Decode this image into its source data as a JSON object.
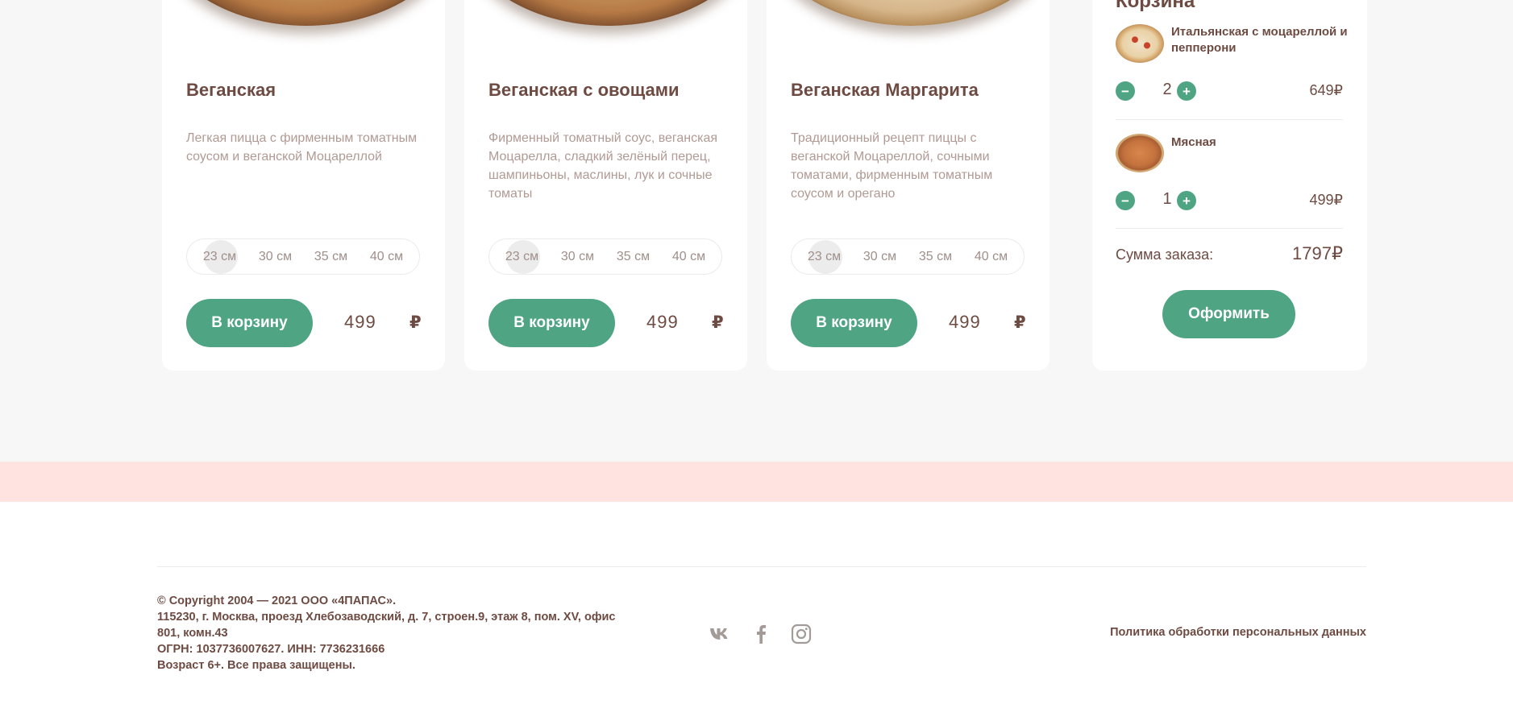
{
  "products": [
    {
      "title": "Веганская",
      "desc": "Легкая пицца с фирменным томатным соусом и веганской Моцареллой",
      "sizes": [
        "23 см",
        "30 см",
        "35 см",
        "40 см"
      ],
      "button": "В корзину",
      "price": "499",
      "currency": "₽"
    },
    {
      "title": "Веганская с овощами",
      "desc": "Фирменный томатный соус, веганская Моцарелла, сладкий зелёный перец, шампиньоны, маслины, лук и сочные томаты",
      "sizes": [
        "23 см",
        "30 см",
        "35 см",
        "40 см"
      ],
      "button": "В корзину",
      "price": "499",
      "currency": "₽"
    },
    {
      "title": "Веганская Маргарита",
      "desc": "Традиционный рецепт пиццы с веганской Моцареллой, сочными томатами, фирменным томатным соусом и орегано",
      "sizes": [
        "23 см",
        "30 см",
        "35 см",
        "40 см"
      ],
      "button": "В корзину",
      "price": "499",
      "currency": "₽"
    }
  ],
  "basket": {
    "title": "Корзина",
    "items": [
      {
        "name": "Итальянская с моцареллой и пепперони",
        "qty": "2",
        "price": "649₽",
        "minus": "−",
        "plus": "+"
      },
      {
        "name": "Мясная",
        "qty": "1",
        "price": "499₽",
        "minus": "−",
        "plus": "+"
      }
    ],
    "total_label": "Сумма заказа:",
    "total_value": "1797₽",
    "order_button": "Оформить"
  },
  "footer": {
    "lines": [
      "© Copyright 2004 — 2021 ООО «4ПАПАС».",
      "115230, г. Москва, проезд Хлебозаводский, д. 7, строен.9, этаж 8, пом. XV, офис",
      "801, комн.43",
      "ОГРН: 1037736007627.  ИНН: 7736231666",
      "Возраст 6+.  Все права защищены."
    ],
    "socials": [
      "vk-icon",
      "facebook-icon",
      "instagram-icon"
    ],
    "policy": "Политика обработки персональных данных"
  },
  "colors": {
    "accent": "#4fa583",
    "text": "#6e4b42",
    "band": "#ffe3e1"
  }
}
